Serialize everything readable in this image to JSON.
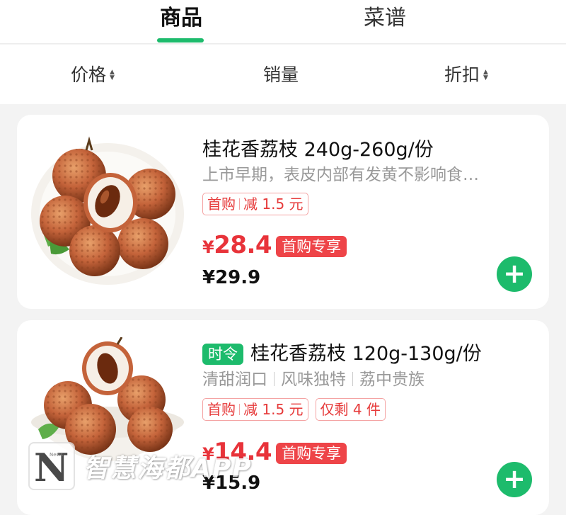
{
  "tabs": [
    {
      "label": "商品",
      "active": true
    },
    {
      "label": "菜谱",
      "active": false
    }
  ],
  "sort_bar": {
    "price": "价格",
    "sales": "销量",
    "discount": "折扣"
  },
  "products": [
    {
      "title": "桂花香荔枝 240g-260g/份",
      "description": "上市早期，表皮内部有发黄不影响食…",
      "tags": [
        {
          "parts": [
            "首购",
            "减 1.5 元"
          ]
        }
      ],
      "sale_price": "28.4",
      "currency": "¥",
      "sale_badge": "首购专享",
      "original_price": "¥29.9",
      "add_icon": "plus-icon"
    },
    {
      "season_tag": "时令",
      "title": "桂花香荔枝 120g-130g/份",
      "description_parts": [
        "清甜润口",
        "风味独特",
        "荔中贵族"
      ],
      "tags": [
        {
          "parts": [
            "首购",
            "减 1.5 元"
          ]
        },
        {
          "parts": [
            "仅剩 4 件"
          ]
        }
      ],
      "sale_price": "14.4",
      "currency": "¥",
      "sale_badge": "首购专享",
      "original_price": "¥15.9",
      "add_icon": "plus-icon"
    }
  ],
  "watermark": {
    "logo_letter": "N",
    "logo_small": "News",
    "text": "智慧海都APP"
  },
  "colors": {
    "accent_green": "#1dbb6c",
    "price_red": "#e8333a",
    "badge_red": "#ee4448"
  }
}
